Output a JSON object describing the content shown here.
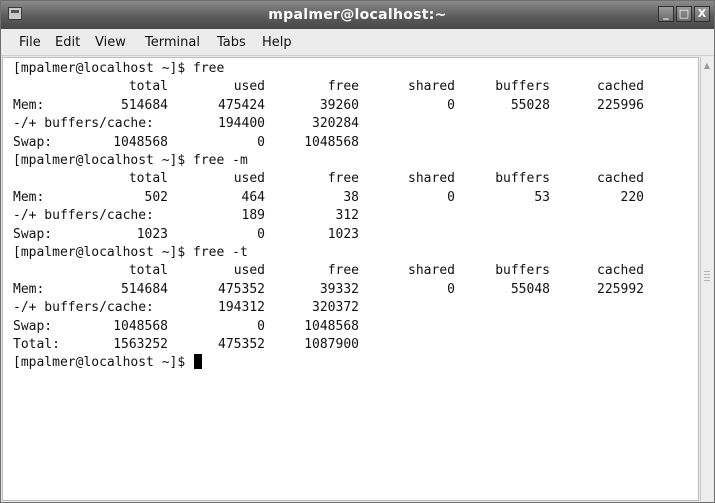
{
  "window": {
    "title": "mpalmer@localhost:~",
    "buttons": {
      "minimize": "_",
      "maximize": "□",
      "close": "X"
    }
  },
  "menu": [
    "File",
    "Edit",
    "View",
    "Terminal",
    "Tabs",
    "Help"
  ],
  "terminal": {
    "prompt": "[mpalmer@localhost ~]$",
    "blocks": [
      {
        "command": "free",
        "headers": [
          "total",
          "used",
          "free",
          "shared",
          "buffers",
          "cached"
        ],
        "mem": {
          "label": "Mem:",
          "values": [
            "514684",
            "475424",
            "39260",
            "0",
            "55028",
            "225996"
          ]
        },
        "buffers": {
          "label": "-/+ buffers/cache:",
          "values": [
            "194400",
            "320284"
          ]
        },
        "swap": {
          "label": "Swap:",
          "values": [
            "1048568",
            "0",
            "1048568"
          ]
        }
      },
      {
        "command": "free -m",
        "headers": [
          "total",
          "used",
          "free",
          "shared",
          "buffers",
          "cached"
        ],
        "mem": {
          "label": "Mem:",
          "values": [
            "502",
            "464",
            "38",
            "0",
            "53",
            "220"
          ]
        },
        "buffers": {
          "label": "-/+ buffers/cache:",
          "values": [
            "189",
            "312"
          ]
        },
        "swap": {
          "label": "Swap:",
          "values": [
            "1023",
            "0",
            "1023"
          ]
        }
      },
      {
        "command": "free -t",
        "headers": [
          "total",
          "used",
          "free",
          "shared",
          "buffers",
          "cached"
        ],
        "mem": {
          "label": "Mem:",
          "values": [
            "514684",
            "475352",
            "39332",
            "0",
            "55048",
            "225992"
          ]
        },
        "buffers": {
          "label": "-/+ buffers/cache:",
          "values": [
            "194312",
            "320372"
          ]
        },
        "swap": {
          "label": "Swap:",
          "values": [
            "1048568",
            "0",
            "1048568"
          ]
        },
        "total": {
          "label": "Total:",
          "values": [
            "1563252",
            "475352",
            "1087900"
          ]
        }
      }
    ]
  }
}
